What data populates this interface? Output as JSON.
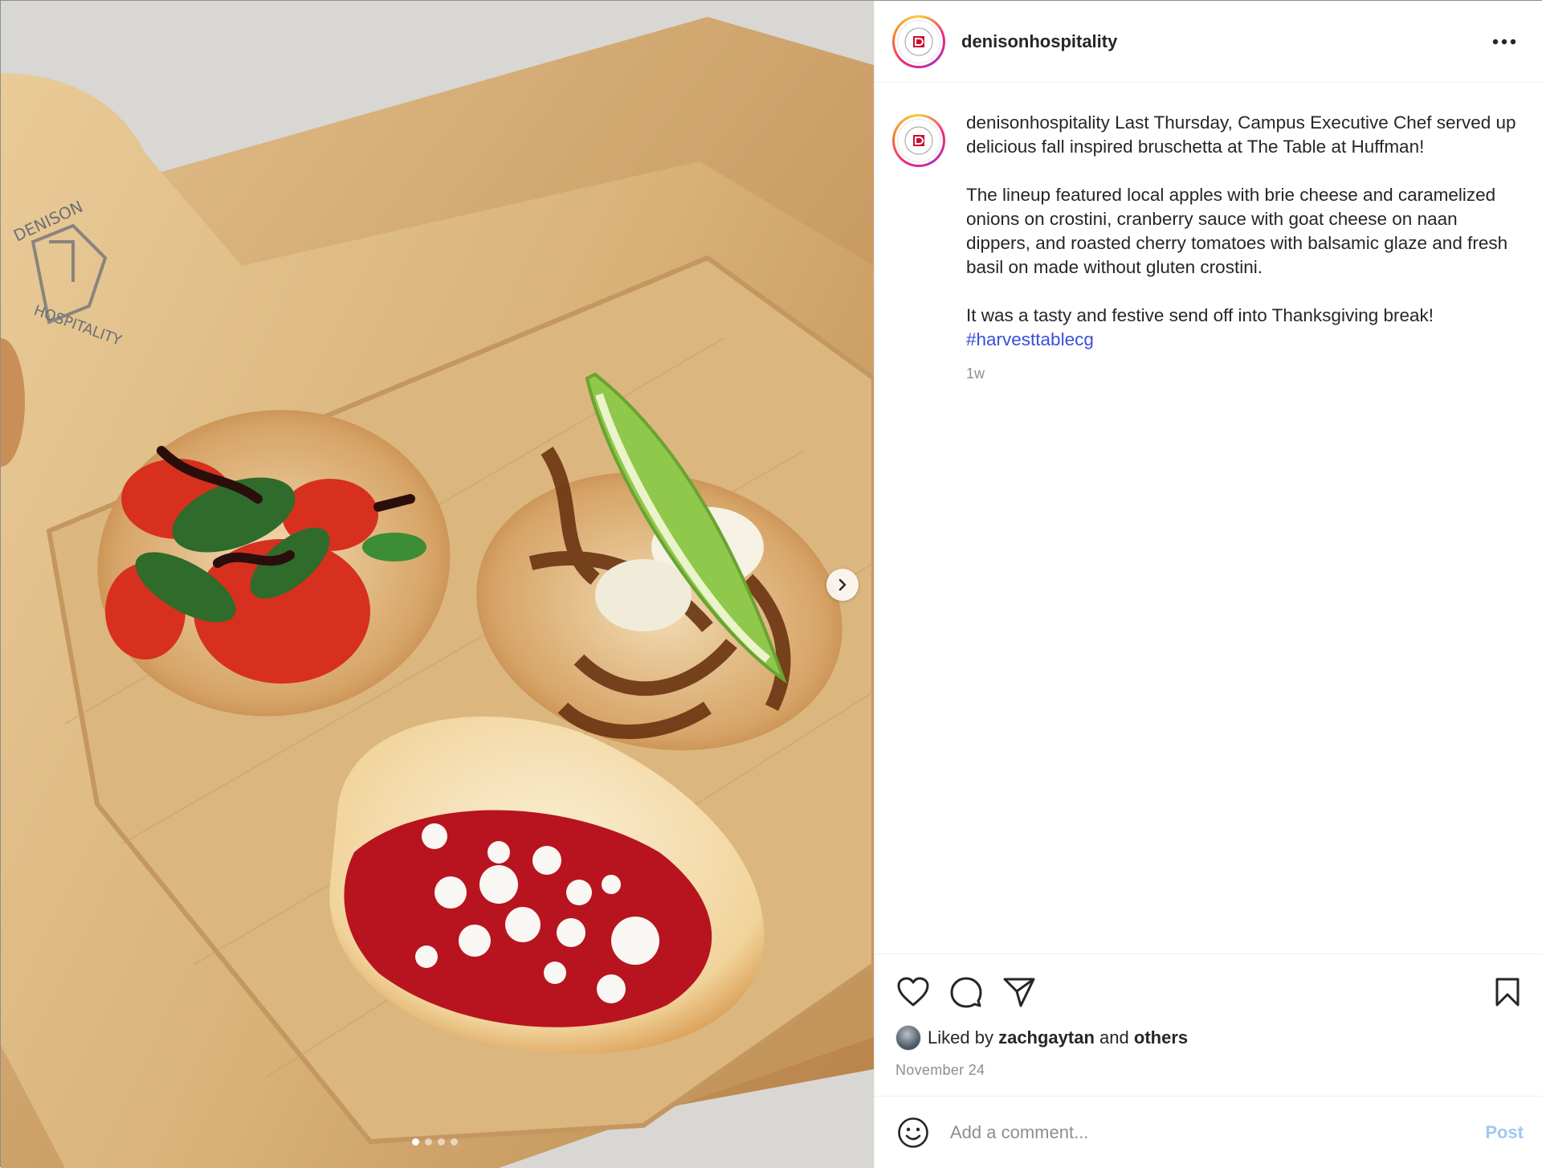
{
  "post": {
    "username": "denisonhospitality",
    "avatar_icon": "denison-hospitality-logo",
    "more_icon": "more-options-icon",
    "media": {
      "description_icon": "food-photo",
      "carousel_count": 4,
      "carousel_active_index": 0,
      "next_icon": "chevron-right-icon"
    },
    "caption": {
      "username": "denisonhospitality",
      "line1": "Last Thursday, Campus Executive Chef served up delicious fall inspired bruschetta at The Table at Huffman!",
      "para2": "The lineup featured local apples with brie cheese and caramelized onions on crostini, cranberry sauce with goat cheese on naan dippers, and roasted cherry tomatoes with balsamic glaze and fresh basil on made without gluten crostini.",
      "para3": "It was a tasty and festive send off into Thanksgiving break!",
      "hashtag": "#harvesttablecg",
      "time_ago": "1w"
    },
    "actions": {
      "like_icon": "heart-icon",
      "comment_icon": "comment-icon",
      "share_icon": "send-icon",
      "save_icon": "bookmark-icon"
    },
    "likes": {
      "prefix": "Liked by",
      "user": "zachgaytan",
      "joiner": "and",
      "others": "others"
    },
    "date": "November 24",
    "comment": {
      "emoji_icon": "emoji-icon",
      "placeholder": "Add a comment...",
      "post_label": "Post"
    }
  },
  "colors": {
    "hashtag": "#3a4fd8",
    "post_button": "#9fc8f5",
    "muted_text": "#8e8e8e"
  }
}
